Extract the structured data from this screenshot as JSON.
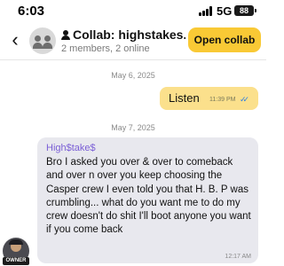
{
  "status_bar": {
    "time": "6:03",
    "network": "5G",
    "battery": "88"
  },
  "header": {
    "title": "Collab: highstakes...",
    "subtitle": "2 members, 2 online",
    "open_button": "Open collab",
    "back_icon": "chevron-left-icon",
    "title_icon": "person-icon",
    "group_icon": "group-avatar-icon"
  },
  "colors": {
    "accent": "#f9c935",
    "outgoing_bubble": "#fbe08c",
    "incoming_bubble": "#e8e8ee",
    "sender_name": "#7b5fd6",
    "read_check": "#2d7de0"
  },
  "messages": [
    {
      "date": "May 6, 2025",
      "direction": "outgoing",
      "text": "Listen",
      "time": "11:39 PM",
      "status": "read"
    },
    {
      "date": "May 7, 2025",
      "direction": "incoming",
      "sender": "High$take$",
      "text": "Bro I asked you over & over to comeback and over n over you keep choosing the Casper crew I even told you that H. B. P was crumbling... what do you want me to do my crew doesn't do shit I'll boot anyone you want if you come back",
      "time": "12:17 AM",
      "badge": "OWNER"
    }
  ]
}
